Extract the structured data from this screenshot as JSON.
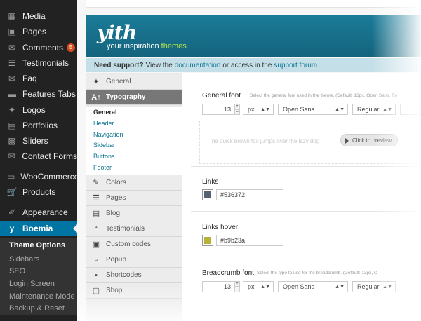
{
  "sidebar": {
    "items": [
      {
        "label": "Media",
        "icon": "media-icon"
      },
      {
        "label": "Pages",
        "icon": "pages-icon"
      },
      {
        "label": "Comments",
        "icon": "comments-icon",
        "badge": "5"
      },
      {
        "label": "Testimonials",
        "icon": "testimonials-icon"
      },
      {
        "label": "Faq",
        "icon": "faq-icon"
      },
      {
        "label": "Features Tabs",
        "icon": "features-tabs-icon"
      },
      {
        "label": "Logos",
        "icon": "pin-icon"
      },
      {
        "label": "Portfolios",
        "icon": "portfolios-icon"
      },
      {
        "label": "Sliders",
        "icon": "sliders-icon"
      },
      {
        "label": "Contact Forms",
        "icon": "contact-forms-icon"
      },
      {
        "label": "WooCommerce",
        "icon": "woocommerce-icon"
      },
      {
        "label": "Products",
        "icon": "products-icon"
      },
      {
        "label": "Appearance",
        "icon": "appearance-icon"
      },
      {
        "label": "Boemia",
        "icon": "yith-icon"
      }
    ],
    "submenu": [
      "Theme Options",
      "Sidebars",
      "SEO",
      "Login Screen",
      "Maintenance Mode",
      "Backup & Reset"
    ]
  },
  "banner": {
    "logo": "yith",
    "tagline_pre": "your inspiration",
    "tagline_hl": "themes"
  },
  "support": {
    "bold": "Need support?",
    "t1": "View the",
    "link1": "documentation",
    "t2": "or access in the",
    "link2": "support forum"
  },
  "options_nav": {
    "general": "General",
    "typography": "Typography",
    "sub": [
      "General",
      "Header",
      "Navigation",
      "Sidebar",
      "Buttons",
      "Footer"
    ],
    "rest": [
      {
        "label": "Colors",
        "icon": "pen-icon"
      },
      {
        "label": "Pages",
        "icon": "list-icon"
      },
      {
        "label": "Blog",
        "icon": "document-icon"
      },
      {
        "label": "Testimonials",
        "icon": "quote-icon"
      },
      {
        "label": "Custom codes",
        "icon": "code-icon"
      },
      {
        "label": "Popup",
        "icon": "popup-icon"
      },
      {
        "label": "Shortcodes",
        "icon": "shortcodes-icon"
      },
      {
        "label": "Shop",
        "icon": "shop-icon"
      }
    ]
  },
  "general_font": {
    "label": "General font",
    "desc": "Select the general font used in the theme. (Default: 13px, Open Sans, Re",
    "size": "13",
    "unit": "px",
    "family": "Open Sans",
    "weight": "Regular",
    "preview_text": "The quick brown fox jumps over the lazy dog",
    "preview_button": "Click to preview"
  },
  "links": {
    "label": "Links",
    "value": "#536372",
    "color": "#536372"
  },
  "links_hover": {
    "label": "Links hover",
    "value": "#b9b23a",
    "color": "#b9b23a"
  },
  "breadcrumb_font": {
    "label": "Breadcrumb font",
    "desc": "Select the type to use for the breadcrumb. (Default: 13px, O",
    "size": "13",
    "unit": "px",
    "family": "Open Sans",
    "weight": "Regular"
  },
  "colors": {
    "sidebar_bg": "#222222",
    "active": "#0074a2",
    "banner": "#1b7c99",
    "badge": "#d54e21"
  }
}
